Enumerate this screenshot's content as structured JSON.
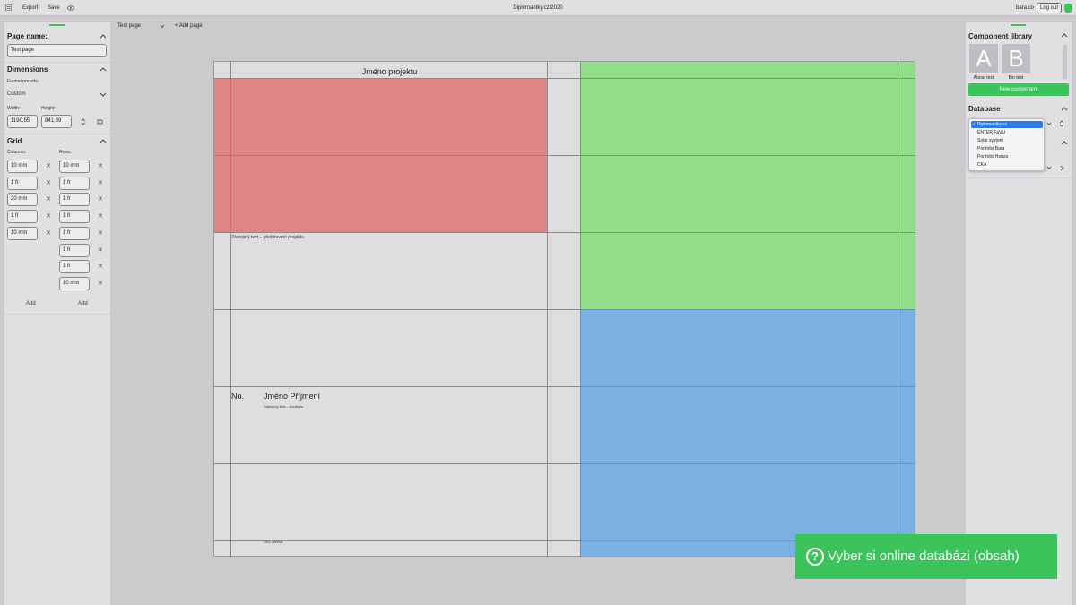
{
  "topbar": {
    "export_label": "Export",
    "save_label": "Save",
    "title": "Diplomantky.cz/2020",
    "user": "bara.co",
    "logout_label": "Log out"
  },
  "left_panel": {
    "page_name_heading": "Page name:",
    "page_name_value": "Test page",
    "dimensions_heading": "Dimensions",
    "format_presets_label": "Format presets:",
    "format_preset_value": "Custom",
    "width_label": "Width:",
    "width_value": "1190,55",
    "height_label": "Height:",
    "height_value": "841,89",
    "grid_heading": "Grid",
    "columns_label": "Columns:",
    "rows_label": "Rows:",
    "columns": [
      "10 mm",
      "1 fr",
      "20 mm",
      "1 fr",
      "10 mm"
    ],
    "rows": [
      "10 mm",
      "1 fr",
      "1 fr",
      "1 fr",
      "1 fr",
      "1 fr",
      "1 fr",
      "10 mm"
    ],
    "add_column_label": "Add",
    "add_row_label": "Add"
  },
  "toolbar": {
    "page_select_value": "Test page",
    "add_page_label": "+ Add page"
  },
  "canvas": {
    "title": "Jméno projektu",
    "intro_text": "Zástupný text – představení projektu",
    "number_label": "No.",
    "name_label": "Jméno Příjmení",
    "bio_text": "Zástupný text – životopis",
    "url_text": "URL adresa",
    "colors": {
      "red": "#de8686",
      "green": "#93dc89",
      "blue": "#7bb1e0"
    }
  },
  "right_panel": {
    "component_library_heading": "Component library",
    "components": [
      {
        "letter": "A",
        "label": "About text"
      },
      {
        "letter": "B",
        "label": "Bio text"
      }
    ],
    "new_component_label": "New component",
    "database_heading": "Database",
    "database_options": [
      "Diplomantky.cz",
      "ENTER FaVU",
      "Solar system",
      "Portfolio Bara",
      "Portfolio Honza",
      "CKA"
    ],
    "selected_database": "Diplomantky.cz"
  },
  "toast": {
    "message": "Vyber si online databázi (obsah)"
  },
  "accent_color": "#3cc35c"
}
